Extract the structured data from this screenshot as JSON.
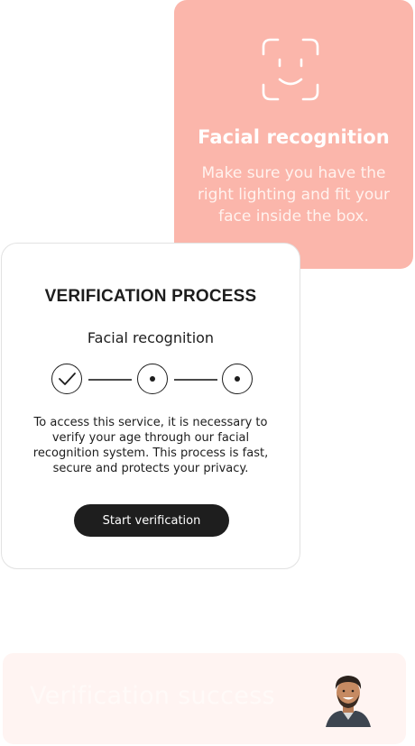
{
  "face_card": {
    "title": "Facial recognition",
    "description": "Make sure you have the right lighting and fit your face inside the box.",
    "icon": "face-scan-icon",
    "background": "#fbb6ab"
  },
  "verify_card": {
    "title": "VERIFICATION PROCESS",
    "subtitle": "Facial recognition",
    "steps": [
      {
        "state": "completed",
        "icon": "check-icon"
      },
      {
        "state": "pending",
        "icon": "dot-icon"
      },
      {
        "state": "pending",
        "icon": "dot-icon"
      }
    ],
    "description": "To access this service, it is necessary to verify your age through our facial recognition system. This process is fast, secure and protects your privacy.",
    "button_label": "Start verification"
  },
  "success_toast": {
    "text": "Verification success",
    "avatar": "user-avatar"
  }
}
